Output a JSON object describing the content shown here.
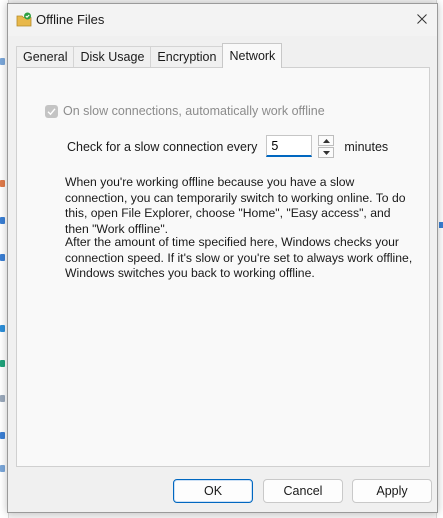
{
  "window": {
    "title": "Offline Files"
  },
  "tabs": [
    {
      "label": "General",
      "active": false
    },
    {
      "label": "Disk Usage",
      "active": false
    },
    {
      "label": "Encryption",
      "active": false
    },
    {
      "label": "Network",
      "active": true
    }
  ],
  "network": {
    "slow_connection_checkbox": {
      "label": "On slow connections, automatically work offline",
      "checked": true,
      "disabled": true
    },
    "check_frequency": {
      "prefix": "Check for a slow connection every",
      "value": "5",
      "suffix": "minutes"
    },
    "paragraph1": "When you're working offline because you have a slow connection, you can temporarily switch to working online. To do this, open File Explorer, choose \"Home\", \"Easy access\", and then \"Work offline\".",
    "paragraph2": "After the amount of time specified here, Windows checks your connection speed. If it's slow or you're set to always work offline, Windows switches you back to working offline."
  },
  "buttons": {
    "ok": "OK",
    "cancel": "Cancel",
    "apply": "Apply"
  },
  "colors": {
    "accent": "#0067c0",
    "icon_green": "#2ea043",
    "icon_folder": "#e8b84a"
  }
}
